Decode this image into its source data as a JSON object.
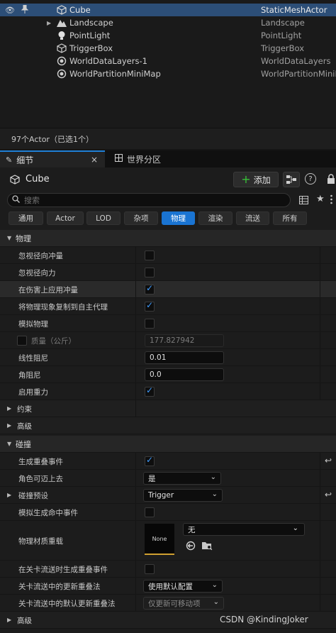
{
  "outliner": {
    "rows": [
      {
        "name": "Cube",
        "type": "StaticMeshActor",
        "selected": true,
        "icon": "cube-icon"
      },
      {
        "name": "Landscape",
        "type": "Landscape",
        "selected": false,
        "icon": "landscape-icon"
      },
      {
        "name": "PointLight",
        "type": "PointLight",
        "selected": false,
        "icon": "light-bulb-icon"
      },
      {
        "name": "TriggerBox",
        "type": "TriggerBox",
        "selected": false,
        "icon": "trigger-box-icon"
      },
      {
        "name": "WorldDataLayers-1",
        "type": "WorldDataLayers",
        "selected": false,
        "icon": "sphere-icon"
      },
      {
        "name": "WorldPartitionMiniMap",
        "type": "WorldPartitionMiniMap",
        "selected": false,
        "icon": "sphere-icon"
      }
    ],
    "footer": "97个Actor（已选1个）"
  },
  "tabs": {
    "details": "细节",
    "world_partition": "世界分区",
    "close": "×"
  },
  "details": {
    "title": "Cube",
    "add_label": "添加",
    "help": "?",
    "search_placeholder": "搜索",
    "filters": [
      "通用",
      "Actor",
      "LOD",
      "杂项",
      "物理",
      "渲染",
      "流送",
      "所有"
    ],
    "active_filter": "物理"
  },
  "props": {
    "physics_category": "物理",
    "ignore_radial_impulse": "忽视径向冲量",
    "ignore_radial_force": "忽视径向力",
    "apply_impulse_on_damage": "在伤害上应用冲量",
    "replicate_physics": "将物理现象复制到自主代理",
    "simulate_physics": "模拟物理",
    "mass": "质量（公斤）",
    "mass_value": "177.827942",
    "linear_damping": "线性阻尼",
    "linear_damping_value": "0.01",
    "angular_damping": "角阻尼",
    "angular_damping_value": "0.0",
    "enable_gravity": "启用重力",
    "constraints": "约束",
    "advanced": "高级",
    "collision_category": "碰撞",
    "generate_overlap_events": "生成重叠事件",
    "can_character_step_up": "角色可迈上去",
    "can_character_step_up_value": "是",
    "collision_presets": "碰撞预设",
    "collision_presets_value": "Trigger",
    "sim_hit_events": "模拟生成命中事件",
    "phys_material_override": "物理材质重载",
    "material_thumb": "None",
    "material_value": "无",
    "generate_overlap_on_level_streaming": "在关卡流送时生成重叠事件",
    "update_overlaps_method": "关卡流送中的更新重叠法",
    "update_overlaps_method_value": "使用默认配置",
    "default_update_overlaps_method": "关卡流送中的默认更新重叠法",
    "default_update_overlaps_method_value": "仅更新可移动项",
    "advanced2": "高级"
  },
  "watermark": "CSDN @KindingJoker"
}
